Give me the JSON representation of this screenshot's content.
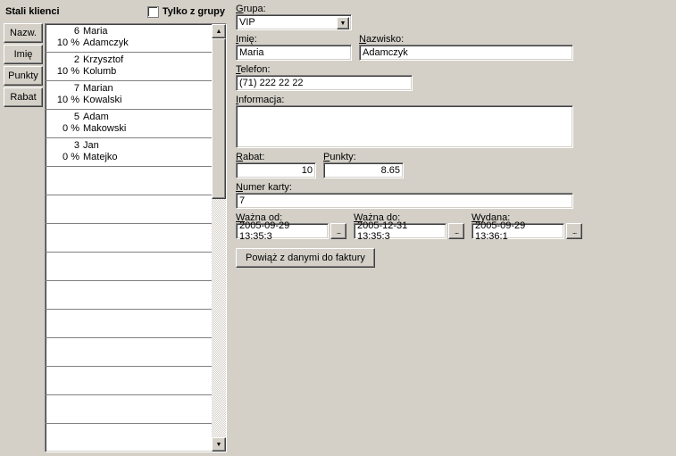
{
  "header": {
    "title": "Stali klienci",
    "group_filter_label": "Tylko z grupy",
    "group_filter_checked": false
  },
  "sort_buttons": [
    "Nazw.",
    "Imię",
    "Punkty",
    "Rabat"
  ],
  "clients": [
    {
      "num": "6",
      "pct": "10 %",
      "first": "Maria",
      "last": "Adamczyk"
    },
    {
      "num": "2",
      "pct": "10 %",
      "first": "Krzysztof",
      "last": "Kolumb"
    },
    {
      "num": "7",
      "pct": "10 %",
      "first": "Marian",
      "last": "Kowalski"
    },
    {
      "num": "5",
      "pct": "0 %",
      "first": "Adam",
      "last": "Makowski"
    },
    {
      "num": "3",
      "pct": "0 %",
      "first": "Jan",
      "last": "Matejko"
    }
  ],
  "list_blank_rows": 9,
  "form": {
    "labels": {
      "grupa": "Grupa:",
      "imie": "Imię:",
      "nazwisko": "Nazwisko:",
      "telefon": "Telefon:",
      "informacja": "Informacja:",
      "rabat": "Rabat:",
      "punkty": "Punkty:",
      "numer_karty": "Numer karty:",
      "wazna_od": "Ważna od:",
      "wazna_do": "Ważna do:",
      "wydana": "Wydana:"
    },
    "values": {
      "grupa": "VIP",
      "imie": "Maria",
      "nazwisko": "Adamczyk",
      "telefon": "(71) 222 22 22",
      "informacja": "",
      "rabat": "10",
      "punkty": "8.65",
      "numer_karty": "7",
      "wazna_od": "2005-09-29 13:35:3",
      "wazna_do": "2005-12-31 13:35:3",
      "wydana": "2005-09-29 13:36:1"
    },
    "date_picker_glyph": "...",
    "link_button": "Powiąż z danymi do faktury"
  }
}
